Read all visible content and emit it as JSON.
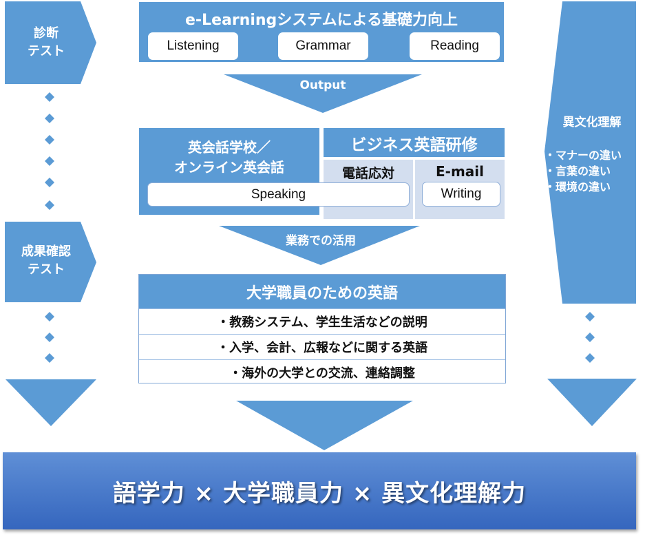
{
  "colors": {
    "accent_blue": "#5b9bd5",
    "light_blue_panel": "#d3deef",
    "banner_top": "#5f8fd6",
    "banner_bottom": "#3566be"
  },
  "left_column": {
    "diagnostic_test": {
      "line1": "診断",
      "line2": "テスト",
      "icon": "pentagon-arrow-right"
    },
    "result_test": {
      "line1": "成果確認",
      "line2": "テスト",
      "icon": "pentagon-arrow-right"
    },
    "connector_icon": "diamond"
  },
  "elearning": {
    "title": "e-Learningシステムによる基礎力向上",
    "skills": [
      "Listening",
      "Grammar",
      "Reading"
    ]
  },
  "arrow_output": {
    "label": "Output"
  },
  "conversation_school": {
    "line1": "英会話学校／",
    "line2": "オンライン英会話",
    "skill": "Speaking"
  },
  "business_training": {
    "title": "ビジネス英語研修",
    "phone": "電話応対",
    "email": "E-mail",
    "email_skill": "Writing"
  },
  "arrow_work": {
    "label": "業務での活用"
  },
  "university_english": {
    "title": "大学職員のための英語",
    "items": [
      "・教務システム、学生生活などの説明",
      "・入学、会計、広報などに関する英語",
      "・海外の大学との交流、連絡調整"
    ]
  },
  "cross_cultural": {
    "title": "異文化理解",
    "items": [
      "・マナーの違い",
      "・言葉の違い",
      "・環境の違い"
    ]
  },
  "banner": {
    "text": "語学力 × 大学職員力 × 異文化理解力"
  }
}
